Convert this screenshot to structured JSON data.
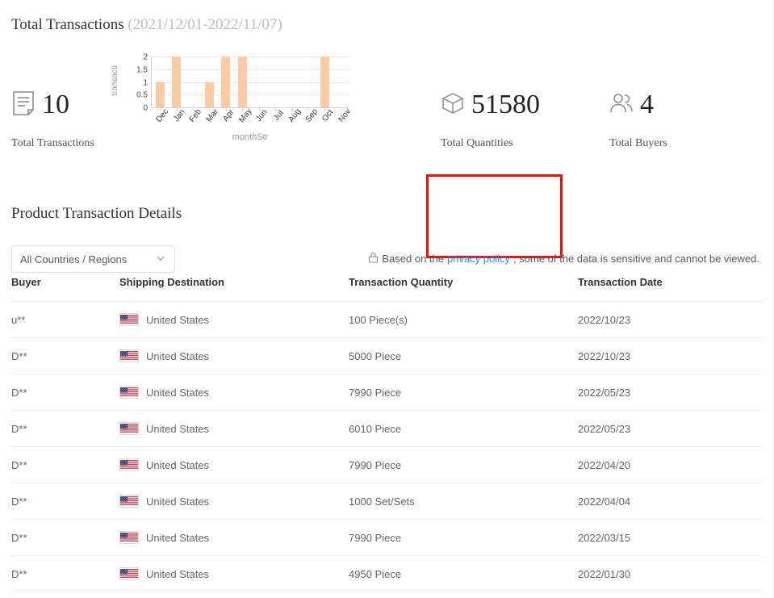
{
  "overview": {
    "title": "Total Transactions",
    "date_range": "(2021/12/01-2022/11/07)",
    "kpis": [
      {
        "value": "10",
        "label": "Total Transactions",
        "icon": "document-icon"
      },
      {
        "value": "51580",
        "label": "Total Quantities",
        "icon": "box-icon",
        "highlighted": true
      },
      {
        "value": "4",
        "label": "Total Buyers",
        "icon": "users-icon"
      }
    ],
    "highlight_color": "#e8120e"
  },
  "chart_data": {
    "type": "bar",
    "title": "",
    "categories": [
      "Dec",
      "Jan",
      "Feb",
      "Mar",
      "Apr",
      "May",
      "Jun",
      "Jul",
      "Aug",
      "Sep",
      "Oct",
      "Nov"
    ],
    "values": [
      1,
      2,
      0,
      1,
      2,
      2,
      0,
      0,
      0,
      0,
      2,
      0
    ],
    "xlabel": "monthStr",
    "ylabel": "transacti",
    "ylim": [
      0,
      2
    ],
    "yticks": [
      "2",
      "1.5",
      "1",
      "0.5",
      "0"
    ],
    "ytick_values": [
      2,
      1.5,
      1,
      0.5,
      0
    ],
    "grid": true,
    "legend": "none",
    "bar_color": "#fbcba4"
  },
  "details": {
    "title": "Product Transaction Details",
    "country_filter": {
      "value": "All Countries / Regions",
      "icon": "chevron-down-icon"
    },
    "privacy_note": {
      "lock_icon": "lock-icon",
      "prefix": "Based on the ",
      "link_text": "privacy policy",
      "suffix": ", some of the data is sensitive and cannot be viewed.",
      "link_color": "#2d8cf0"
    },
    "table": {
      "columns": [
        "Buyer",
        "Shipping Destination",
        "Transaction Quantity",
        "Transaction Date"
      ],
      "rows": [
        {
          "buyer": "u**",
          "destination": "United States",
          "flag": "us-flag-icon",
          "quantity": "100 Piece(s)",
          "date": "2022/10/23"
        },
        {
          "buyer": "D**",
          "destination": "United States",
          "flag": "us-flag-icon",
          "quantity": "5000 Piece",
          "date": "2022/10/23"
        },
        {
          "buyer": "D**",
          "destination": "United States",
          "flag": "us-flag-icon",
          "quantity": "7990 Piece",
          "date": "2022/05/23"
        },
        {
          "buyer": "D**",
          "destination": "United States",
          "flag": "us-flag-icon",
          "quantity": "6010 Piece",
          "date": "2022/05/23"
        },
        {
          "buyer": "D**",
          "destination": "United States",
          "flag": "us-flag-icon",
          "quantity": "7990 Piece",
          "date": "2022/04/20"
        },
        {
          "buyer": "D**",
          "destination": "United States",
          "flag": "us-flag-icon",
          "quantity": "1000 Set/Sets",
          "date": "2022/04/04"
        },
        {
          "buyer": "D**",
          "destination": "United States",
          "flag": "us-flag-icon",
          "quantity": "7990 Piece",
          "date": "2022/03/15"
        },
        {
          "buyer": "D**",
          "destination": "United States",
          "flag": "us-flag-icon",
          "quantity": "4950 Piece",
          "date": "2022/01/30"
        }
      ]
    }
  }
}
